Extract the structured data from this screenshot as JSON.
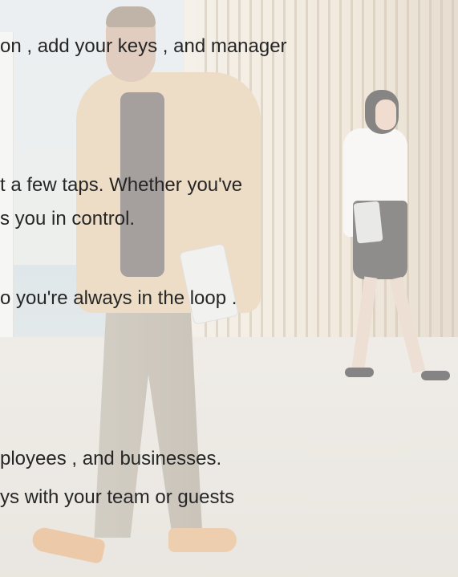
{
  "content": {
    "lines": [
      "on , add your keys , and manager",
      "t a few taps. Whether you've",
      "s you in control.",
      "o you're always in the loop .",
      "ployees , and businesses.",
      "ys with your team or guests"
    ]
  },
  "background": {
    "description_icon": "office-hallway-photo",
    "accent_colors": [
      "#e3c9a3",
      "#4a4746",
      "#f4f3f1"
    ]
  }
}
